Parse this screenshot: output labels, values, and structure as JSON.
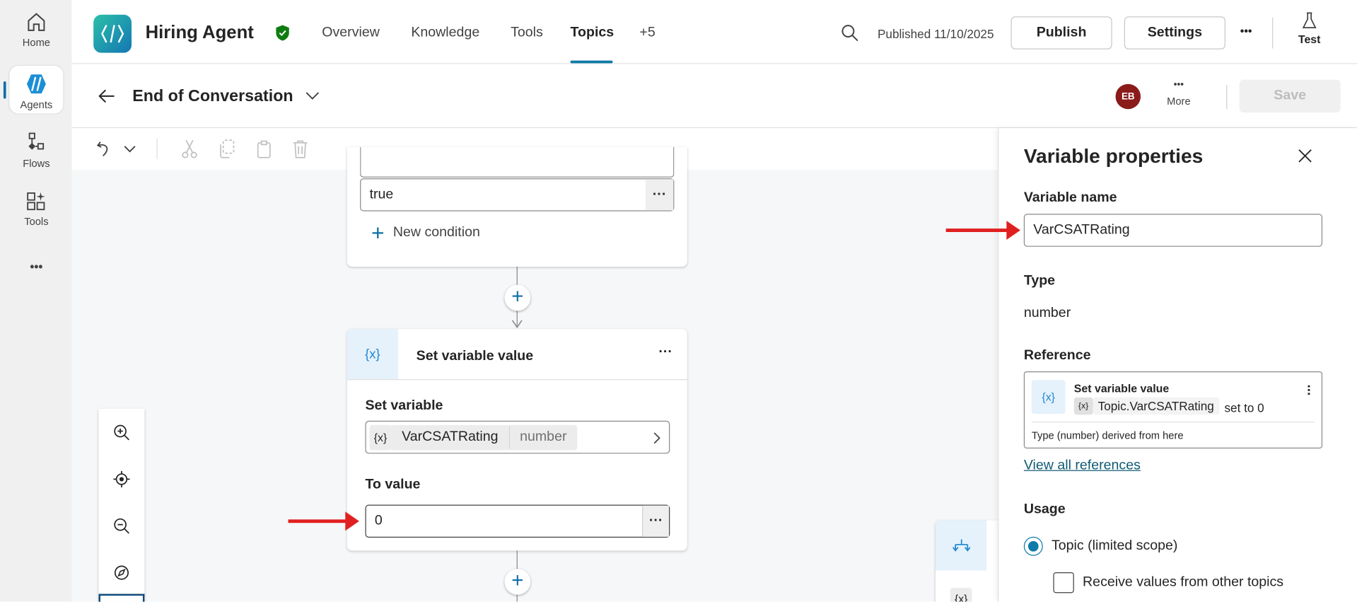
{
  "rail": {
    "items": [
      {
        "label": "Home"
      },
      {
        "label": "Agents"
      },
      {
        "label": "Flows"
      },
      {
        "label": "Tools"
      }
    ],
    "more": "•••"
  },
  "header": {
    "agent_name": "Hiring Agent",
    "tabs": [
      "Overview",
      "Knowledge",
      "Tools",
      "Topics",
      "+5"
    ],
    "active_tab": "Topics",
    "published": "Published 11/10/2025",
    "publish": "Publish",
    "settings": "Settings",
    "more": "•••",
    "test": "Test"
  },
  "topic": {
    "title": "End of Conversation",
    "avatar": "EB",
    "more_label": "More",
    "more": "•••",
    "save": "Save"
  },
  "canvas": {
    "condition_card": {
      "value": "true",
      "new_condition": "New condition"
    },
    "set_var_card": {
      "icon": "{x}",
      "title": "Set variable value",
      "set_variable_label": "Set variable",
      "var_icon": "{x}",
      "var_name": "VarCSATRating",
      "var_type": "number",
      "to_value_label": "To value",
      "to_value": "0"
    },
    "partial_node": {
      "chip": "{x}"
    }
  },
  "panel": {
    "title": "Variable properties",
    "name_label": "Variable name",
    "name_value": "VarCSATRating",
    "type_label": "Type",
    "type_value": "number",
    "reference_label": "Reference",
    "reference": {
      "icon": "{x}",
      "title": "Set variable value",
      "chip_icon": "{x}",
      "chip": "Topic.VarCSATRating",
      "suffix": "set to 0",
      "note": "Type (number) derived from here"
    },
    "view_all": "View all references",
    "usage_label": "Usage",
    "radio_label": "Topic (limited scope)",
    "radio_checked": true,
    "checkbox_label": "Receive values from other topics",
    "checkbox_checked": false
  },
  "colors": {
    "accent": "#0e6ea8",
    "arrow": "#e02020",
    "avatar": "#8b1a1a"
  }
}
